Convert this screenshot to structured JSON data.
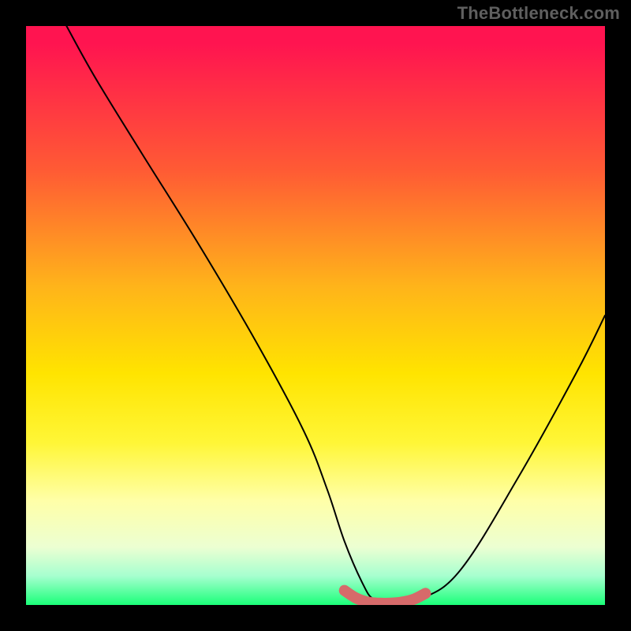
{
  "watermark": "TheBottleneck.com",
  "chart_data": {
    "type": "line",
    "title": "",
    "xlabel": "",
    "ylabel": "",
    "xlim": [
      0,
      100
    ],
    "ylim": [
      0,
      100
    ],
    "gradient_stops": [
      {
        "pos": 0,
        "color": "#ff1450"
      },
      {
        "pos": 25,
        "color": "#ff5b34"
      },
      {
        "pos": 45,
        "color": "#ffb41a"
      },
      {
        "pos": 60,
        "color": "#ffe400"
      },
      {
        "pos": 82,
        "color": "#ffffa8"
      },
      {
        "pos": 95,
        "color": "#a6ffcf"
      },
      {
        "pos": 100,
        "color": "#1aff79"
      }
    ],
    "series": [
      {
        "name": "thin-curve",
        "color": "#000000",
        "width": 2,
        "x": [
          7,
          12,
          20,
          30,
          40,
          48,
          52,
          55,
          58,
          60,
          63,
          68,
          75,
          85,
          95,
          100
        ],
        "y": [
          100,
          91,
          78,
          62,
          45,
          30,
          20,
          11,
          4,
          1,
          0.5,
          1,
          6,
          22,
          40,
          50
        ]
      },
      {
        "name": "thick-highlight",
        "color": "#d66a6a",
        "width": 14,
        "x": [
          55,
          57,
          59,
          61,
          63,
          65,
          67,
          69
        ],
        "y": [
          2.5,
          1.2,
          0.5,
          0.3,
          0.3,
          0.5,
          1.0,
          2.0
        ]
      }
    ]
  }
}
